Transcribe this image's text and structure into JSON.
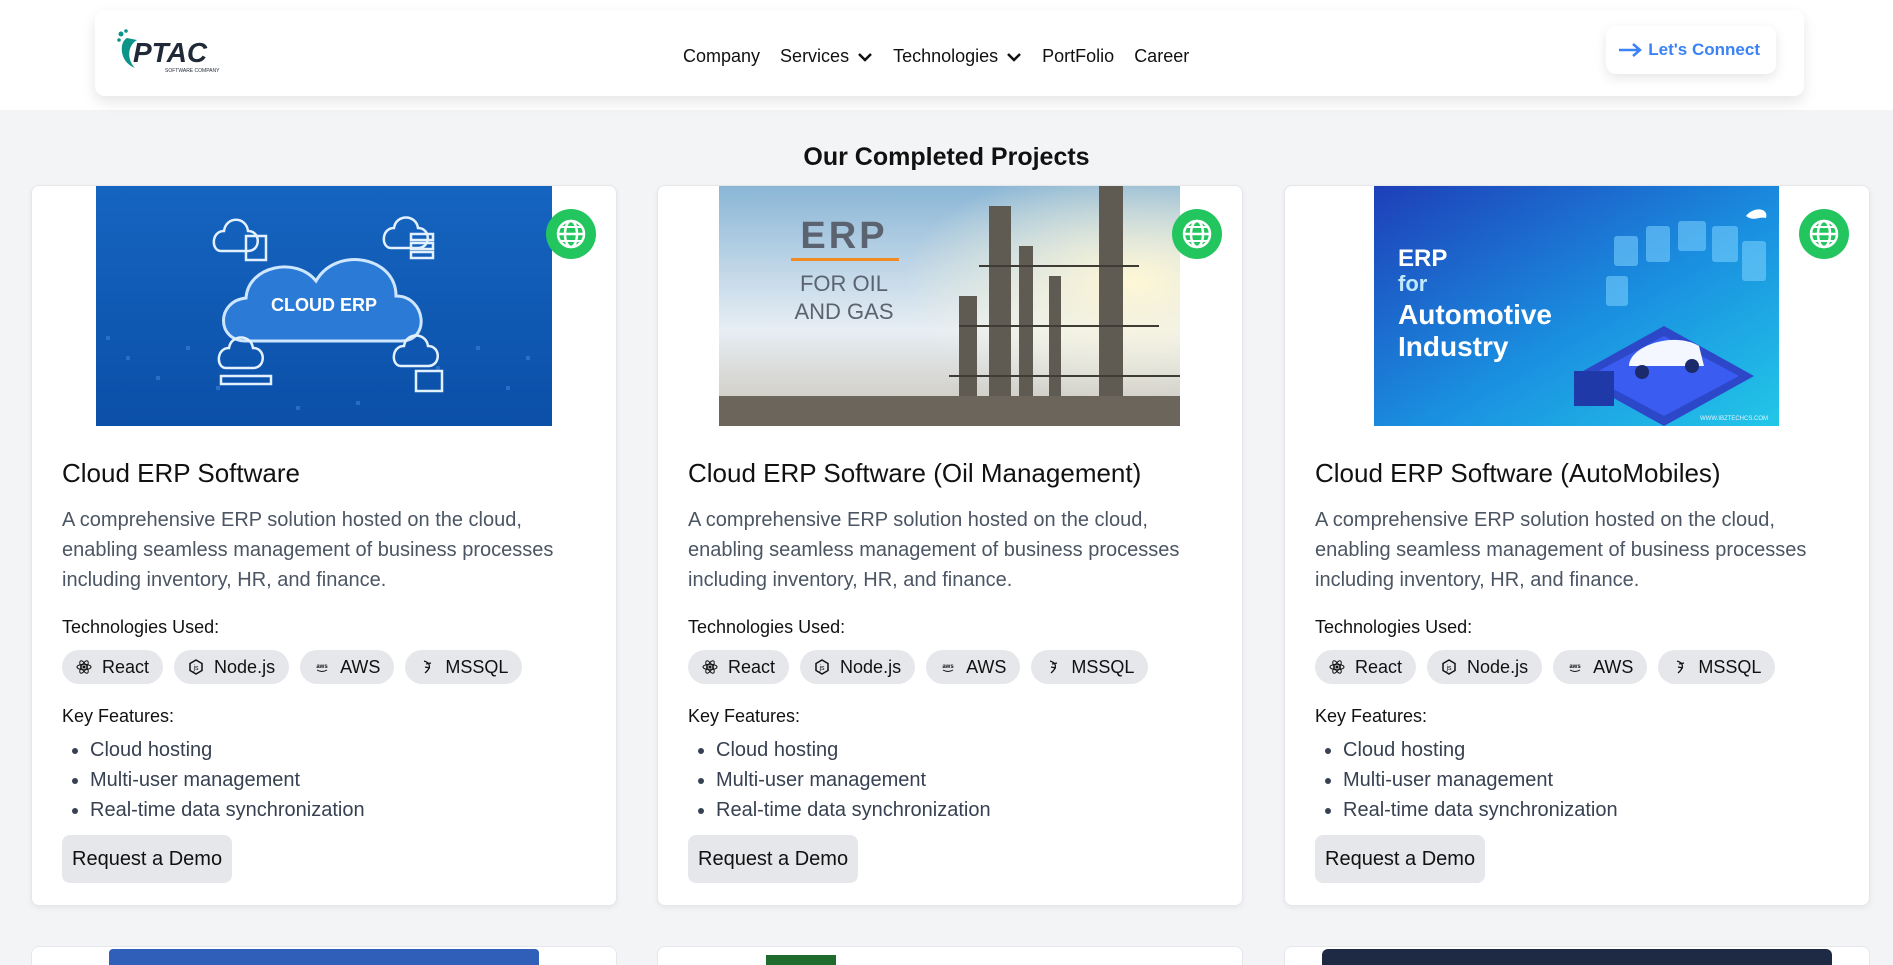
{
  "nav": {
    "logo_text": "PTAC",
    "logo_subtext": "SOFTWARE COMPANY",
    "links": [
      {
        "label": "Company",
        "dropdown": false
      },
      {
        "label": "Services",
        "dropdown": true
      },
      {
        "label": "Technologies",
        "dropdown": true
      },
      {
        "label": "PortFolio",
        "dropdown": false
      },
      {
        "label": "Career",
        "dropdown": false
      }
    ],
    "connect_label": "Let's Connect"
  },
  "section_title": "Our Completed Projects",
  "projects": [
    {
      "title": "Cloud ERP Software",
      "image_text": "CLOUD ERP",
      "description": "A comprehensive ERP solution hosted on the cloud, enabling seamless management of business processes including inventory, HR, and finance.",
      "tech_heading": "Technologies Used:",
      "technologies": [
        "React",
        "Node.js",
        "AWS",
        "MSSQL"
      ],
      "features_heading": "Key Features:",
      "features": [
        "Cloud hosting",
        "Multi-user management",
        "Real-time data synchronization"
      ],
      "demo_label": "Request a Demo"
    },
    {
      "title": "Cloud ERP Software (Oil Management)",
      "image_text": [
        "ERP",
        "FOR OIL",
        "AND GAS"
      ],
      "description": "A comprehensive ERP solution hosted on the cloud, enabling seamless management of business processes including inventory, HR, and finance.",
      "tech_heading": "Technologies Used:",
      "technologies": [
        "React",
        "Node.js",
        "AWS",
        "MSSQL"
      ],
      "features_heading": "Key Features:",
      "features": [
        "Cloud hosting",
        "Multi-user management",
        "Real-time data synchronization"
      ],
      "demo_label": "Request a Demo"
    },
    {
      "title": "Cloud ERP Software (AutoMobiles)",
      "image_text": [
        "ERP",
        "for",
        "Automotive",
        "Industry"
      ],
      "image_footer": "WWW.IBZTECHCS.COM",
      "description": "A comprehensive ERP solution hosted on the cloud, enabling seamless management of business processes including inventory, HR, and finance.",
      "tech_heading": "Technologies Used:",
      "technologies": [
        "React",
        "Node.js",
        "AWS",
        "MSSQL"
      ],
      "features_heading": "Key Features:",
      "features": [
        "Cloud hosting",
        "Multi-user management",
        "Real-time data synchronization"
      ],
      "demo_label": "Request a Demo"
    }
  ],
  "colors": {
    "accent": "#3b82f6",
    "globe": "#22c55e",
    "page_bg": "#f3f4f6",
    "tag_bg": "#e5e7eb"
  }
}
